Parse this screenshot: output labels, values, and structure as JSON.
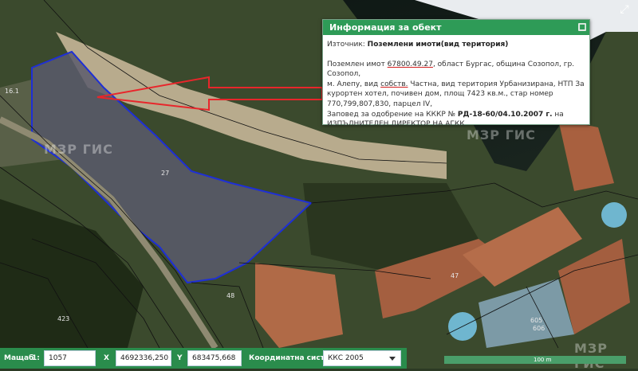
{
  "popup": {
    "title": "Информация за обект",
    "source_label": "Източник:",
    "source_value": "Поземлени имоти(вид територия)",
    "line1_pre": "Поземлен имот ",
    "line1_id": "67800.49.27",
    "line1_post": ", област Бургас, община Созопол, гр. Созопол,",
    "line2_pre": "м. Алепу, вид ",
    "line2_ul": "собств.",
    "line2_post": " Частна, вид територия Урбанизирана, НТП За",
    "line3": "курортен хотел, почивен дом, площ 7423 кв.м., стар номер",
    "line4": "770,799,807,830, парцел IV,",
    "line5_pre": "Заповед за одобрение на КККР № ",
    "line5_bold": "РД-18-60/04.10.2007 г.",
    "line5_post": " на",
    "line6": "ИЗПЪЛНИТЕЛЕН ДИРЕКТОР НА АГКК"
  },
  "bottom_bar": {
    "scale_label": "Мащаб",
    "scale_prefix": "1:",
    "scale_value": "1057",
    "x_label": "X",
    "x_value": "4692336,250",
    "y_label": "Y",
    "y_value": "683475,668",
    "crs_label": "Координатна система",
    "crs_value": "ККС 2005"
  },
  "map": {
    "scale_text": "100 m",
    "watermark": "МЗР ГИС",
    "parcel_labels": [
      "27",
      "47",
      "48",
      "423",
      "605",
      "606",
      "16.1"
    ]
  },
  "colors": {
    "accent": "#2e9b57",
    "parcel_outline": "#1e2fd6",
    "pointer_arrow": "#e8262b"
  }
}
